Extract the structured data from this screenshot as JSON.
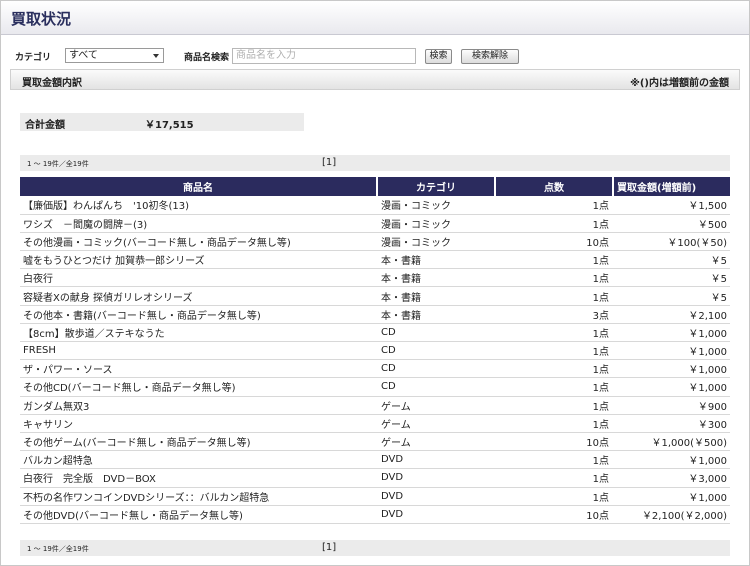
{
  "page": {
    "title": "買取状況"
  },
  "filters": {
    "category_label": "カテゴリ",
    "category_value": "すべて",
    "search_label": "商品名検索",
    "search_placeholder": "商品名を入力",
    "search_button": "検索",
    "clear_button": "検索解除"
  },
  "section": {
    "title": "買取金額内訳",
    "note": "※()内は増額前の金額"
  },
  "summary": {
    "total_label": "合計金額",
    "total_value": "￥17,515"
  },
  "pager": {
    "count_text": "1 ～ 19件／全19件",
    "page_text": "[1]"
  },
  "table": {
    "headers": [
      "商品名",
      "カテゴリ",
      "点数",
      "買取金額(増額前)"
    ],
    "rows": [
      {
        "name": "【廉価版】わんぱんち　'10初冬(13)",
        "category": "漫画・コミック",
        "qty": "1点",
        "amount": "￥1,500"
      },
      {
        "name": "ワシズ　－閻魔の闘牌－(3)",
        "category": "漫画・コミック",
        "qty": "1点",
        "amount": "￥500"
      },
      {
        "name": "その他漫画・コミック(バーコード無し・商品データ無し等)",
        "category": "漫画・コミック",
        "qty": "10点",
        "amount": "￥100(￥50)"
      },
      {
        "name": "嘘をもうひとつだけ 加賀恭一郎シリーズ",
        "category": "本・書籍",
        "qty": "1点",
        "amount": "￥5"
      },
      {
        "name": "白夜行",
        "category": "本・書籍",
        "qty": "1点",
        "amount": "￥5"
      },
      {
        "name": "容疑者Xの献身 探偵ガリレオシリーズ",
        "category": "本・書籍",
        "qty": "1点",
        "amount": "￥5"
      },
      {
        "name": "その他本・書籍(バーコード無し・商品データ無し等)",
        "category": "本・書籍",
        "qty": "3点",
        "amount": "￥2,100"
      },
      {
        "name": "【8cm】散歩道／ステキなうた",
        "category": "CD",
        "qty": "1点",
        "amount": "￥1,000"
      },
      {
        "name": "FRESH",
        "category": "CD",
        "qty": "1点",
        "amount": "￥1,000"
      },
      {
        "name": "ザ・パワー・ソース",
        "category": "CD",
        "qty": "1点",
        "amount": "￥1,000"
      },
      {
        "name": "その他CD(バーコード無し・商品データ無し等)",
        "category": "CD",
        "qty": "1点",
        "amount": "￥1,000"
      },
      {
        "name": "ガンダム無双3",
        "category": "ゲーム",
        "qty": "1点",
        "amount": "￥900"
      },
      {
        "name": "キャサリン",
        "category": "ゲーム",
        "qty": "1点",
        "amount": "￥300"
      },
      {
        "name": "その他ゲーム(バーコード無し・商品データ無し等)",
        "category": "ゲーム",
        "qty": "10点",
        "amount": "￥1,000(￥500)"
      },
      {
        "name": "バルカン超特急",
        "category": "DVD",
        "qty": "1点",
        "amount": "￥1,000"
      },
      {
        "name": "白夜行　完全版　DVD－BOX",
        "category": "DVD",
        "qty": "1点",
        "amount": "￥3,000"
      },
      {
        "name": "不朽の名作ワンコインDVDシリーズ：：バルカン超特急",
        "category": "DVD",
        "qty": "1点",
        "amount": "￥1,000"
      },
      {
        "name": "その他DVD(バーコード無し・商品データ無し等)",
        "category": "DVD",
        "qty": "10点",
        "amount": "￥2,100(￥2,000)"
      }
    ]
  }
}
